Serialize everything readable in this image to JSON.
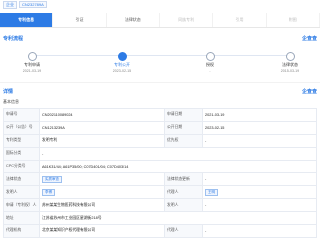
{
  "breadcrumb": {
    "home": "企业",
    "title": "CN232789A"
  },
  "tabs": [
    {
      "label": "专利信息",
      "state": "active"
    },
    {
      "label": "引证",
      "state": "normal"
    },
    {
      "label": "法律状态",
      "state": "normal"
    },
    {
      "label": "同族专利",
      "state": "muted"
    },
    {
      "label": "引用",
      "state": "muted"
    },
    {
      "label": "附图",
      "state": "muted"
    }
  ],
  "timeline": {
    "title": "专利流程",
    "brand": "企查查",
    "items": [
      {
        "label": "专利申请",
        "date": "2021-03-19",
        "active": false
      },
      {
        "label": "专利公开",
        "date": "2023-02-15",
        "active": true
      },
      {
        "label": "授权",
        "date": "-",
        "active": false
      },
      {
        "label": "法律状态",
        "date": "2015-03-19",
        "active": false
      }
    ]
  },
  "details": {
    "title": "详情",
    "brand": "企查查",
    "subtitle": "基本信息",
    "rows": [
      {
        "k1": "申请号",
        "v1": "CN202110089024",
        "k2": "申请日期",
        "v2": "2021-03-19"
      },
      {
        "k1": "公开（公告）号",
        "v1": "CN1213239A",
        "k2": "公开日期",
        "v2": "2023-02-15"
      },
      {
        "k1": "专利类型",
        "v1": "发明专利",
        "k2": "优先权",
        "v2": "-"
      },
      {
        "k1": "国际分类",
        "v1": "-",
        "k2": "",
        "v2": ""
      },
      {
        "k1": "CPC分类号",
        "v1": "A61K31/44; A61P35/00; C07D401/04; C07D403/14",
        "k2": "",
        "v2": ""
      },
      {
        "k1": "法律状态",
        "v1": "实质审查",
        "k2": "法律状态更新",
        "v2": "-"
      },
      {
        "k1": "发明人",
        "v1": "李博",
        "k2": "代理人",
        "v2": "王明"
      },
      {
        "k1": "申请（专利权）人",
        "v1": "苏州某某生物医药科技有限公司",
        "k2": "发明人",
        "v2": "-"
      },
      {
        "k1": "地址",
        "v1": "江苏省苏州市工业园区星湖街218号",
        "k2": "",
        "v2": ""
      },
      {
        "k1": "代理机构",
        "v1": "北京某某知识产权代理有限公司",
        "k2": "代理人",
        "v2": "-"
      }
    ]
  }
}
